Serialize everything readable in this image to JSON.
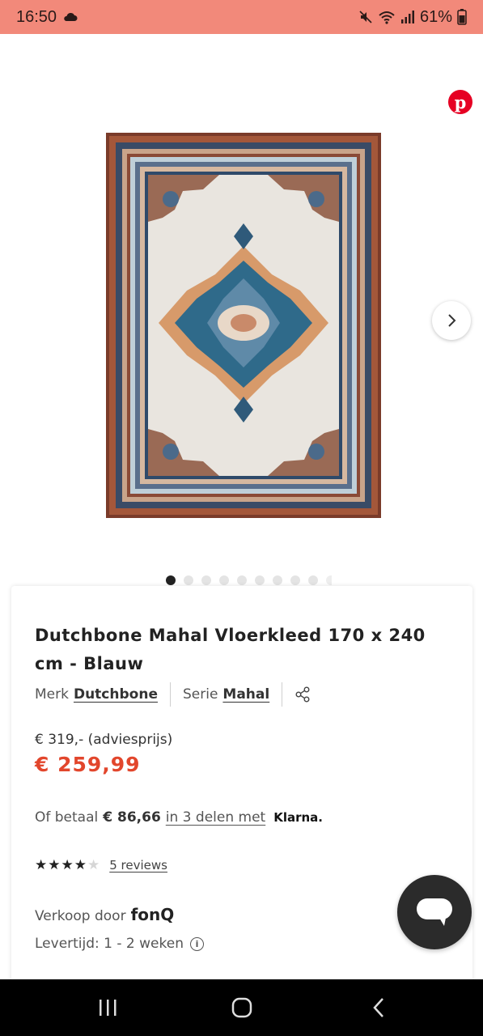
{
  "status_bar": {
    "time": "16:50",
    "battery": "61%",
    "icons": [
      "cloud-icon",
      "mute-icon",
      "wifi-icon",
      "signal-icon",
      "battery-icon"
    ]
  },
  "gallery": {
    "pinterest_icon": "pinterest-icon",
    "next_icon": "chevron-right-icon",
    "total_dots": 10,
    "active_dot": 0
  },
  "product": {
    "title": "Dutchbone Mahal Vloerkleed 170 x 240 cm - Blauw",
    "brand_label": "Merk",
    "brand": "Dutchbone",
    "series_label": "Serie",
    "series": "Mahal",
    "rrp": "€ 319,- (adviesprijs)",
    "price": "€ 259,99",
    "installment_prefix": "Of betaal",
    "installment_amount": "€ 86,66",
    "installment_suffix": "in 3 delen met",
    "klarna": "Klarna.",
    "rating": 4,
    "rating_max": 5,
    "reviews": "5 reviews",
    "seller_label": "Verkoop door",
    "seller": "fonQ",
    "delivery": "Levertijd: 1 - 2 weken"
  },
  "colors": {
    "status_bar": "#f2897a",
    "price": "#e2462c",
    "pinterest": "#e60023",
    "chat": "#2b2b2b"
  }
}
